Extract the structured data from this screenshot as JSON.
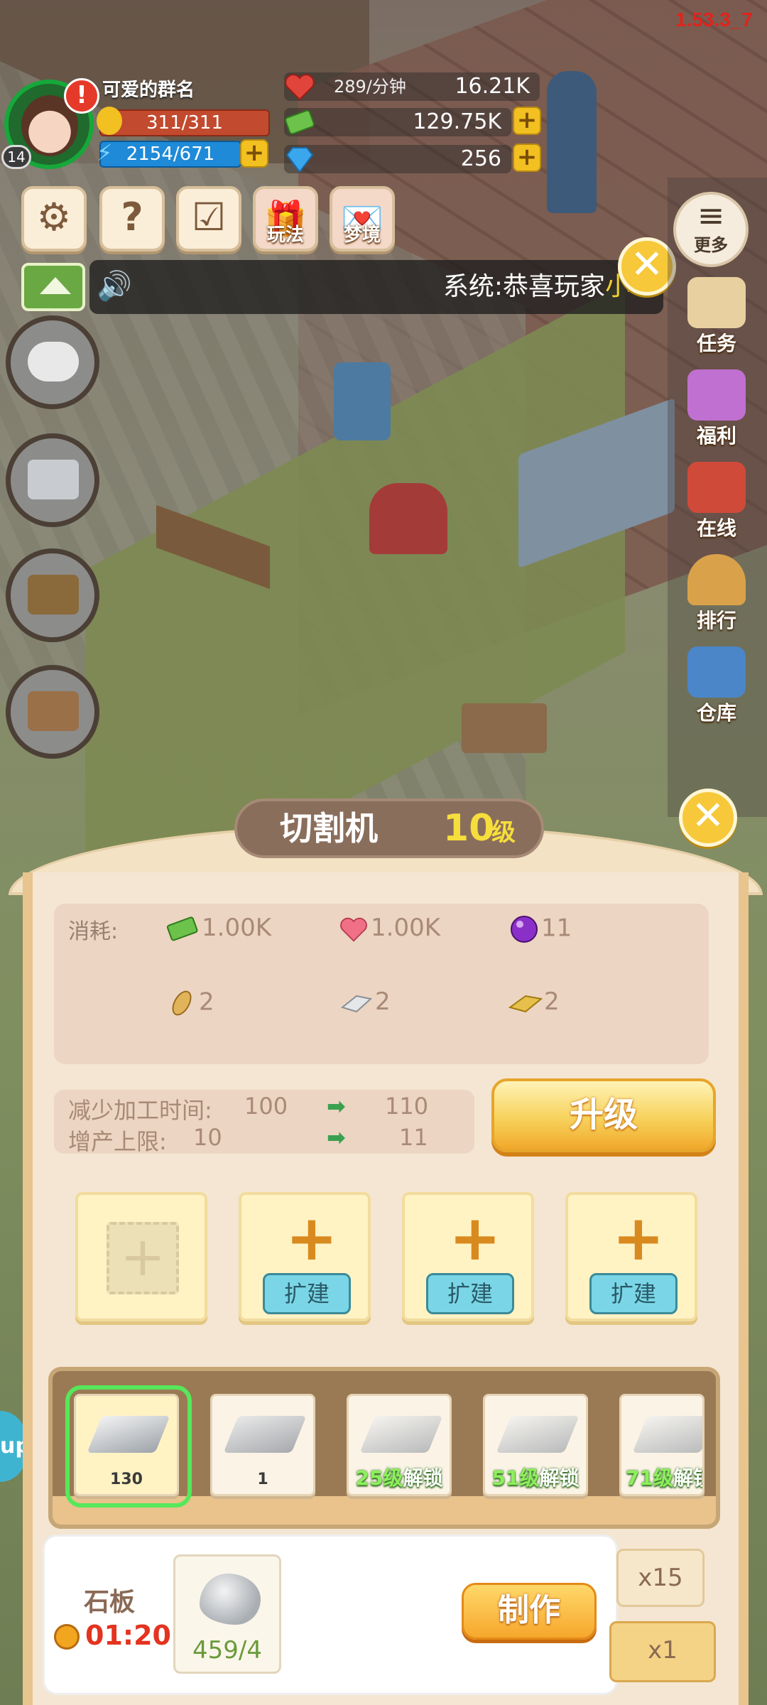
{
  "version": "1.53.3_7",
  "player": {
    "name": "可爱的群名",
    "level": "14",
    "alert": "!",
    "hp": "311/311",
    "energy": "2154/671"
  },
  "resources": {
    "hearts_rate": "289/分钟",
    "hearts": "16.21K",
    "cash": "129.75K",
    "gems": "256",
    "plus": "+"
  },
  "hud_buttons": {
    "settings_icon": "⚙",
    "help_label": "?",
    "calendar_icon": "☑",
    "gameplay_label": "玩法",
    "dream_label": "梦境"
  },
  "marquee": {
    "prefix": "系统:恭喜玩家",
    "highlight": "小草"
  },
  "close_glyph": "✕",
  "right_menu": {
    "more": "更多",
    "items": [
      "任务",
      "福利",
      "在线",
      "排行",
      "仓库"
    ]
  },
  "panel": {
    "title": "切割机",
    "level_num": "10",
    "level_unit": "级",
    "cost_label": "消耗:",
    "costs": {
      "cash": "1.00K",
      "heart": "1.00K",
      "orb": "11",
      "peanut": "2",
      "plate": "2",
      "gold": "2"
    },
    "stats": {
      "time_label": "减少加工时间:",
      "time_from": "100",
      "time_to": "110",
      "cap_label": "增产上限:",
      "cap_from": "10",
      "cap_to": "11",
      "arrow": "➡"
    },
    "upgrade_label": "升级",
    "expand_label": "扩建",
    "items": [
      {
        "count": "130"
      },
      {
        "count": "1"
      },
      {
        "level": "25级",
        "unlock": "解锁"
      },
      {
        "level": "51级",
        "unlock": "解锁"
      },
      {
        "level": "71级",
        "unlock": "解锁"
      }
    ],
    "craft": {
      "name": "石板",
      "time": "01:20",
      "material_count": "459/4",
      "make_label": "制作"
    },
    "multipliers": [
      "x15",
      "x1"
    ]
  },
  "up_tab": "up",
  "colors": {
    "accent_gold": "#f6c83a",
    "hp_red": "#c24a2e",
    "xp_blue": "#1e8ad8",
    "timer_red": "#e33420",
    "select_green": "#56e85a"
  }
}
